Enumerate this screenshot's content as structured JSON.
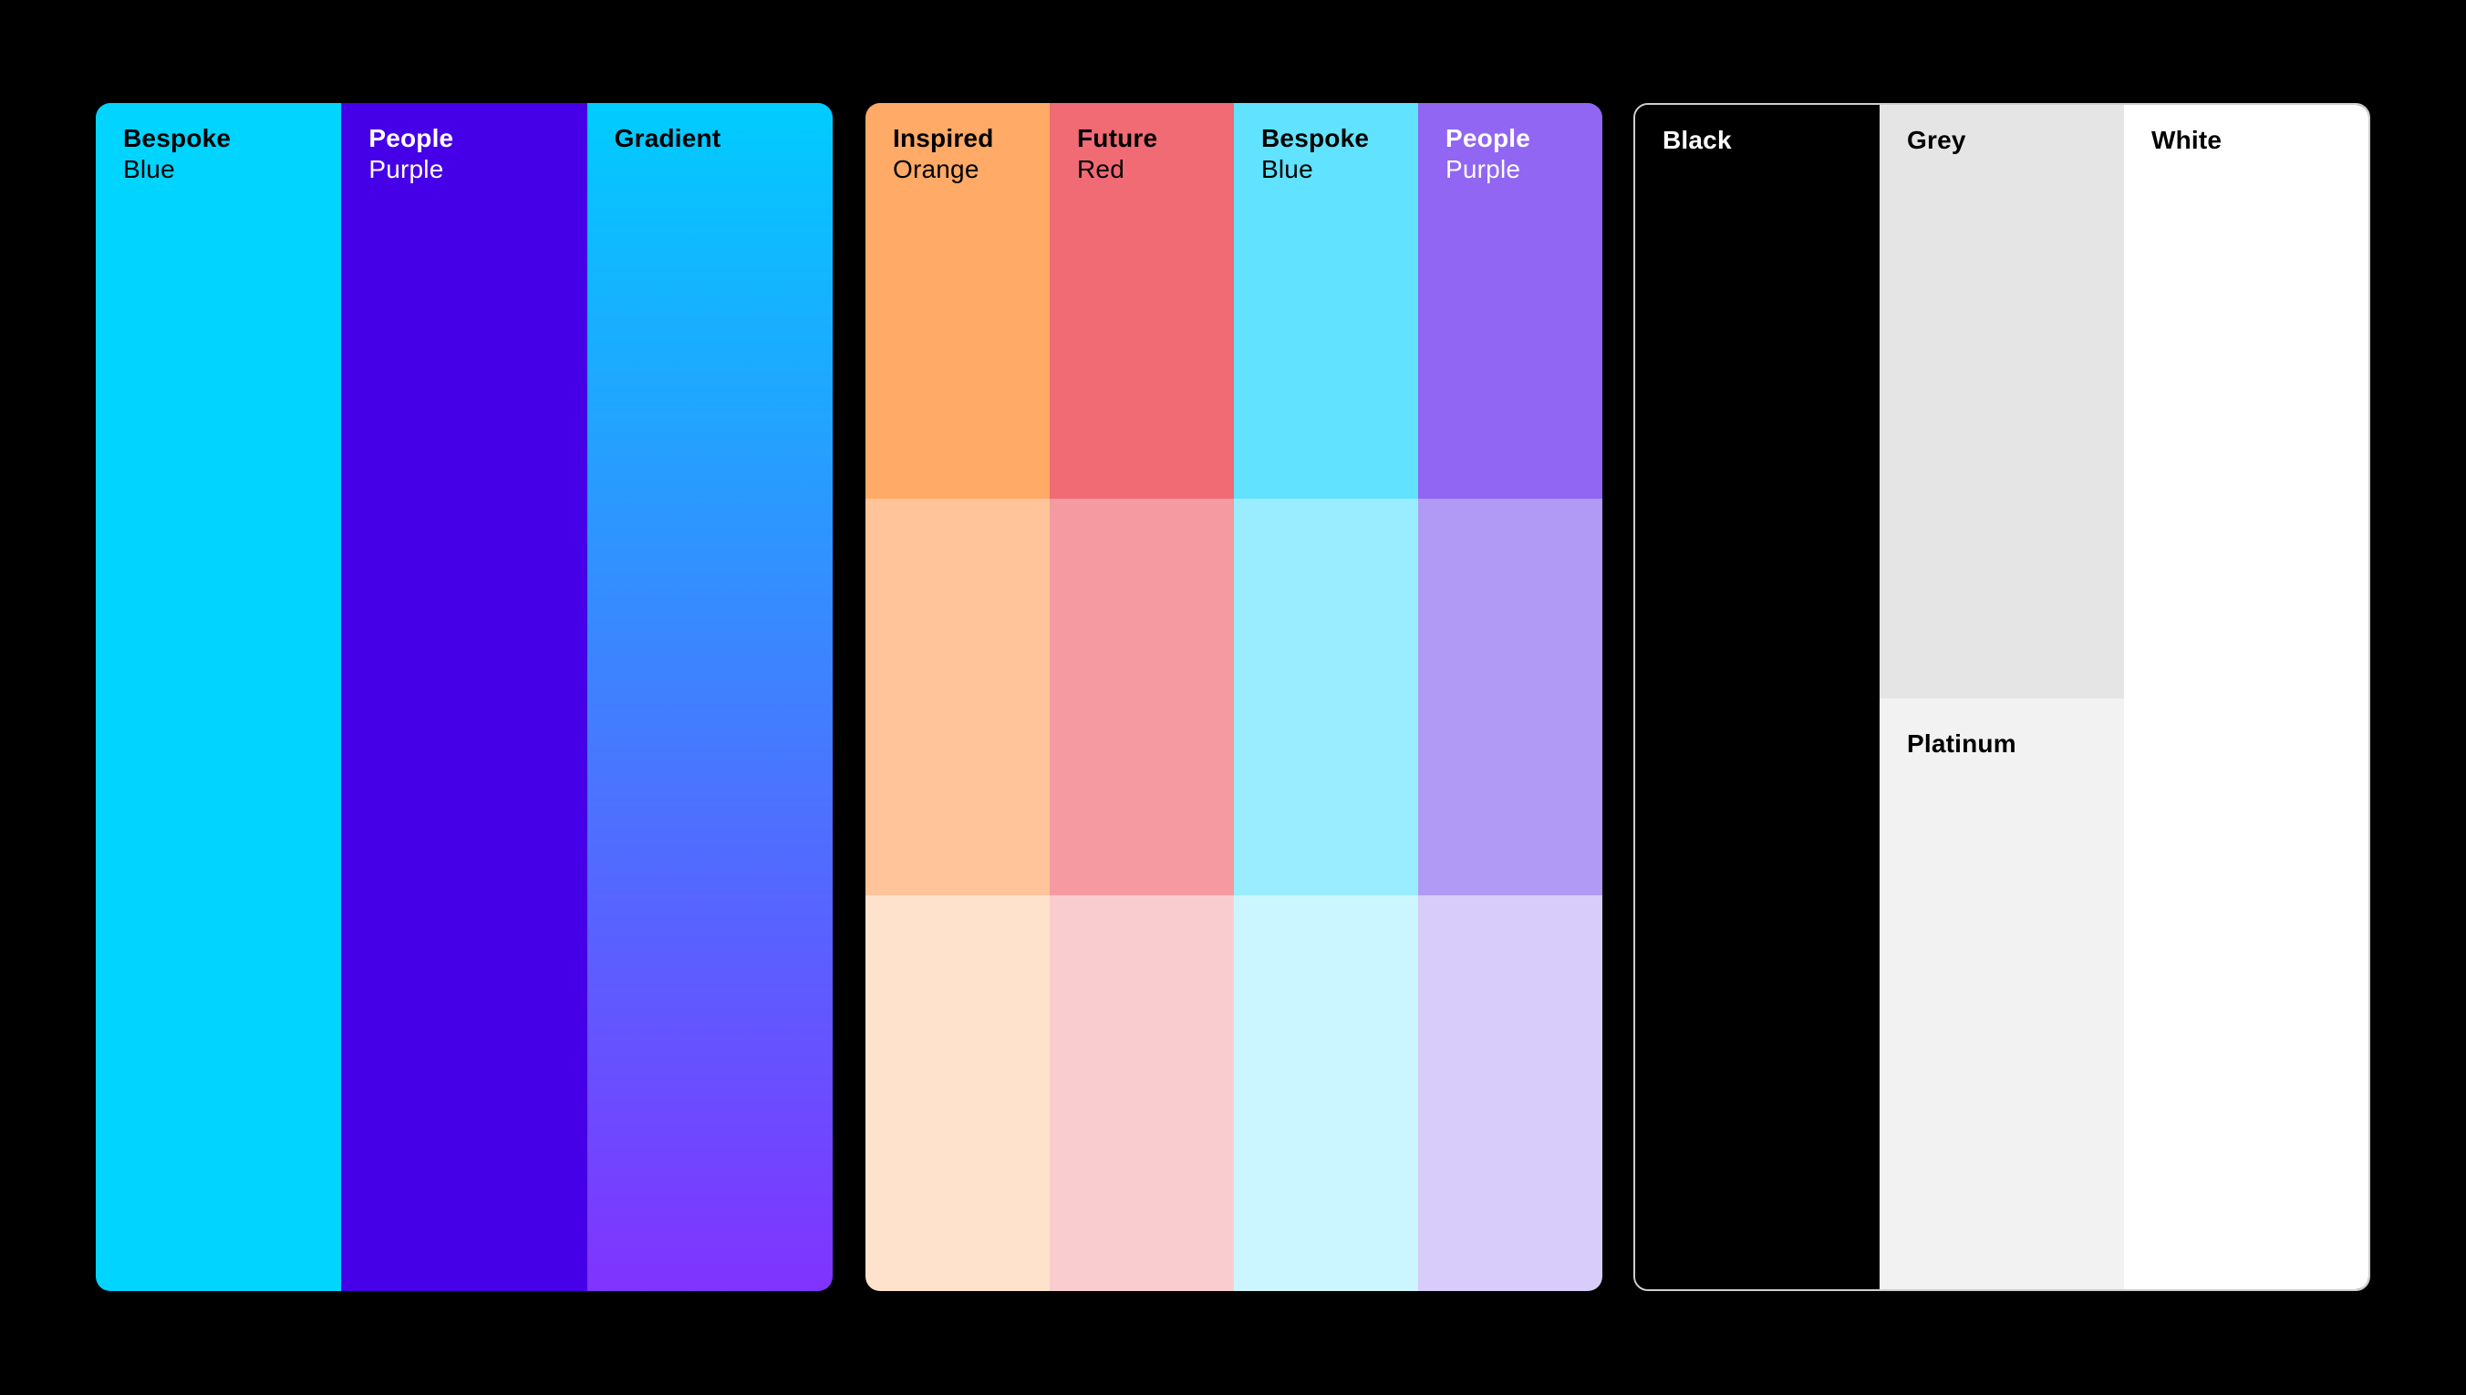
{
  "panels": {
    "primary": {
      "swatches": [
        {
          "name": "Bespoke",
          "sub": "Blue",
          "color": "#00D4FF"
        },
        {
          "name": "People",
          "sub": "Purple",
          "color": "#4500E8"
        },
        {
          "name": "Gradient",
          "sub": "",
          "gradient_from": "#00CCFF",
          "gradient_to": "#8033FF"
        }
      ]
    },
    "secondary": {
      "columns": [
        {
          "name": "Inspired",
          "sub": "Orange",
          "tints": [
            "#FFAA66",
            "#FFC499",
            "#FEE2CC"
          ]
        },
        {
          "name": "Future",
          "sub": "Red",
          "tints": [
            "#F06B74",
            "#F59AA0",
            "#F9CDD0"
          ]
        },
        {
          "name": "Bespoke",
          "sub": "Blue",
          "tints": [
            "#61E3FF",
            "#9AEDFF",
            "#CCF6FF"
          ]
        },
        {
          "name": "People",
          "sub": "Purple",
          "tints": [
            "#9066F2",
            "#B199F6",
            "#D8CCFA"
          ]
        }
      ]
    },
    "neutral": {
      "swatches": [
        {
          "name": "Black",
          "color": "#000000"
        },
        {
          "name": "Grey",
          "color": "#E5E5E5"
        },
        {
          "name": "Platinum",
          "color": "#F2F2F2"
        },
        {
          "name": "White",
          "color": "#FFFFFF"
        }
      ]
    }
  }
}
